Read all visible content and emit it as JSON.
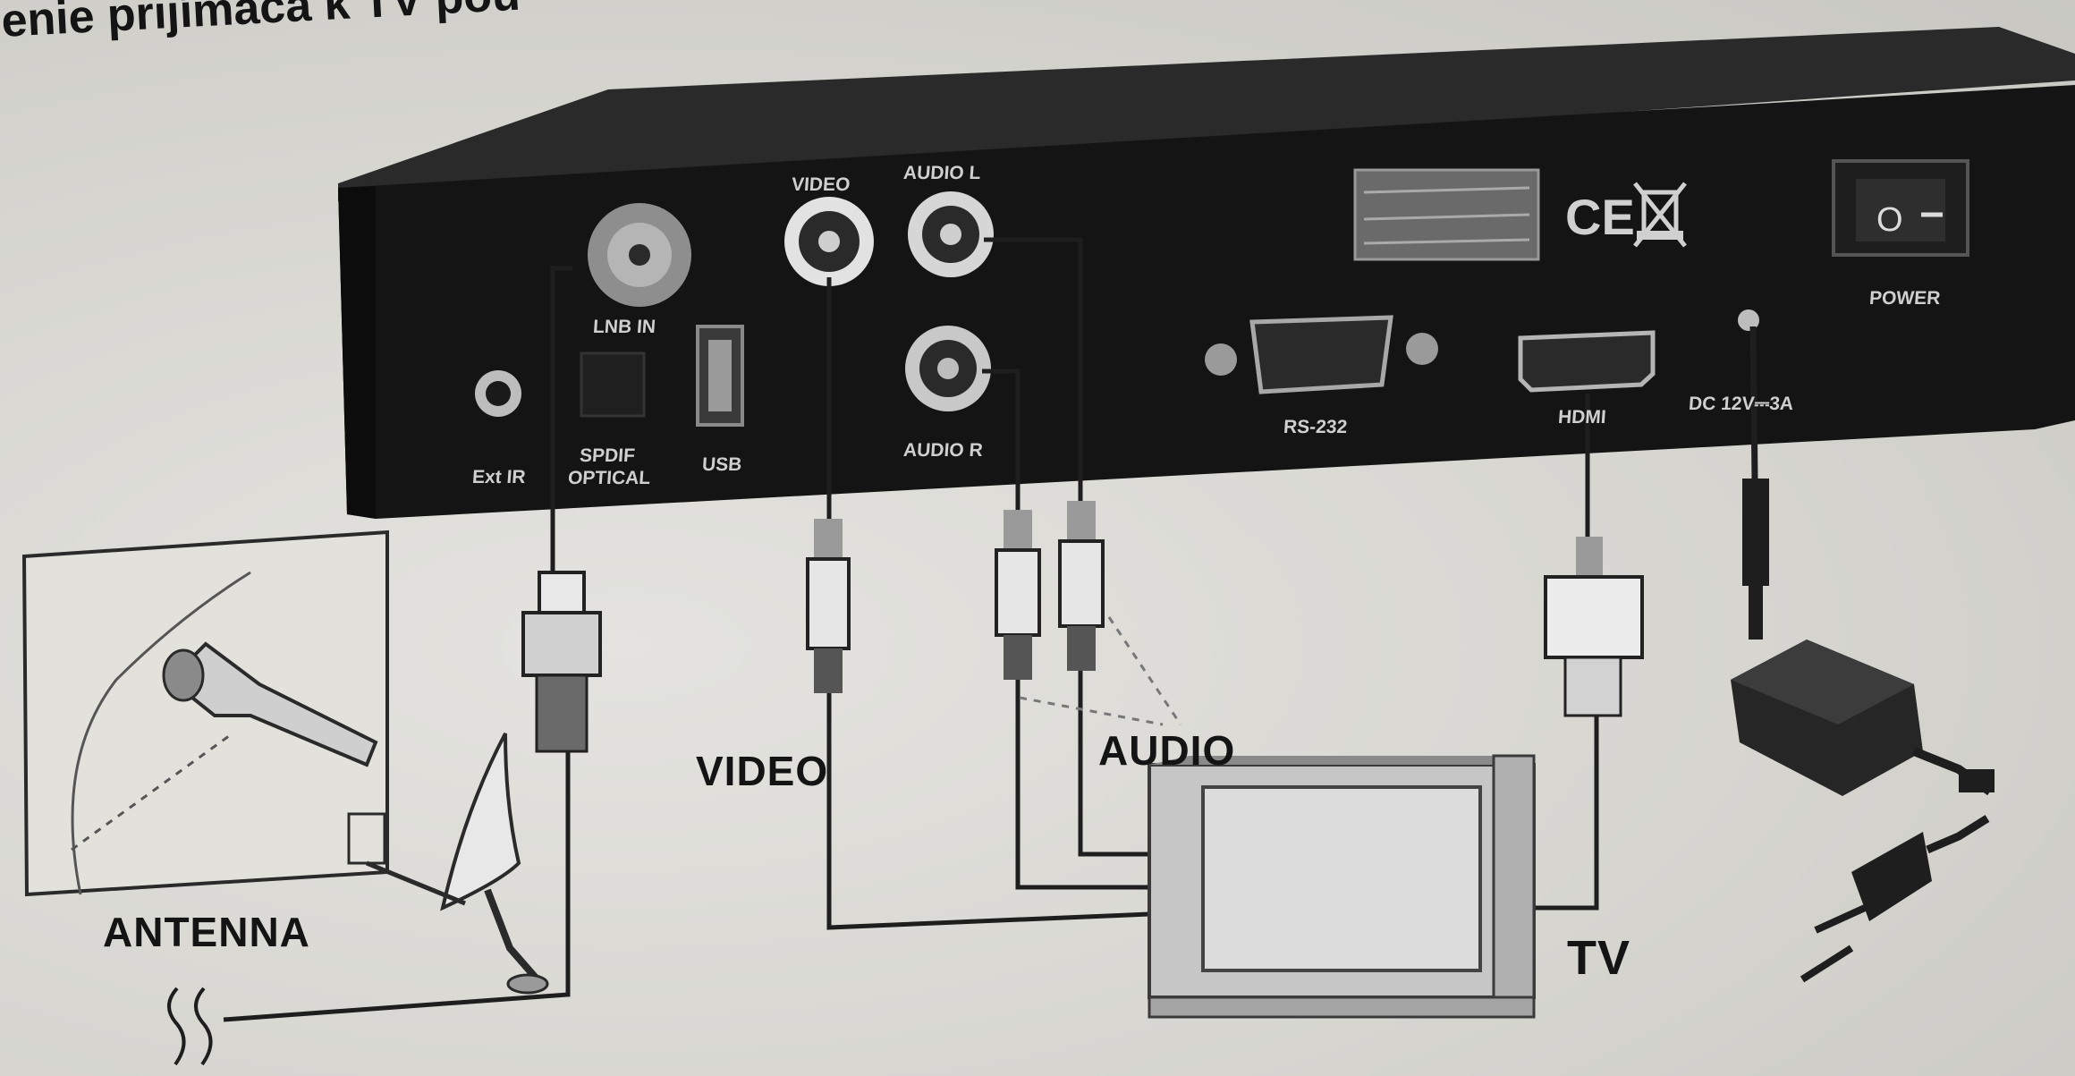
{
  "header": {
    "text": "enie prijímača k TV pou"
  },
  "device": {
    "ports": {
      "ext_ir": "Ext IR",
      "lnb_in": "LNB IN",
      "spdif": "SPDIF",
      "optical": "OPTICAL",
      "usb": "USB",
      "video": "VIDEO",
      "audio_l": "AUDIO L",
      "audio_r": "AUDIO R",
      "rs232": "RS-232",
      "hdmi": "HDMI",
      "dc": "DC 12V⎓3A",
      "power": "POWER"
    }
  },
  "labels": {
    "video": "VIDEO",
    "audio": "AUDIO",
    "antenna": "ANTENNA",
    "tv": "TV"
  },
  "colors": {
    "device": "#141414",
    "paper": "#d9d8d3",
    "line": "#1e1e1e"
  },
  "icons": [
    "ce-mark-icon",
    "weee-bin-icon",
    "power-switch-icon",
    "satellite-dish-icon",
    "ground-wave-icon",
    "power-plug-icon",
    "power-adapter-icon"
  ]
}
